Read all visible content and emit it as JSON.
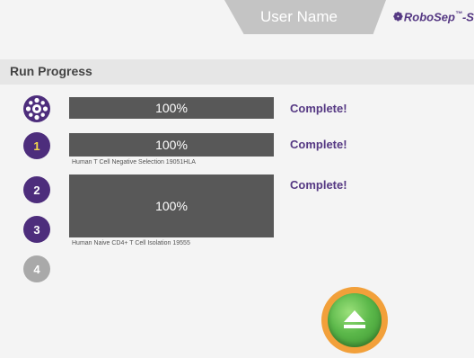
{
  "header": {
    "user_name": "User Name",
    "logo_text": "RoboSep",
    "logo_suffix": "-S"
  },
  "page": {
    "title": "Run Progress"
  },
  "steps": [
    {
      "label": "1",
      "state": "active"
    },
    {
      "label": "2",
      "state": "done"
    },
    {
      "label": "3",
      "state": "done"
    },
    {
      "label": "4",
      "state": "inactive"
    }
  ],
  "progress_rows": [
    {
      "percent_label": "100%",
      "percent": 100,
      "status": "Complete!",
      "sub_label": ""
    },
    {
      "percent_label": "100%",
      "percent": 100,
      "status": "Complete!",
      "sub_label": "Human T Cell Negative Selection 19051HLA"
    },
    {
      "percent_label": "100%",
      "percent": 100,
      "status": "Complete!",
      "sub_label": "Human Naive CD4+ T Cell Isolation 19555"
    }
  ],
  "icons": {
    "carousel": "carousel-icon",
    "eject": "eject-icon"
  },
  "colors": {
    "brand_purple": "#553883",
    "step_purple": "#4d2d7c",
    "bar_grey": "#585858",
    "eject_ring": "#f2a03a",
    "eject_green": "#5bb84a",
    "active_step_number": "#f5d94a"
  }
}
